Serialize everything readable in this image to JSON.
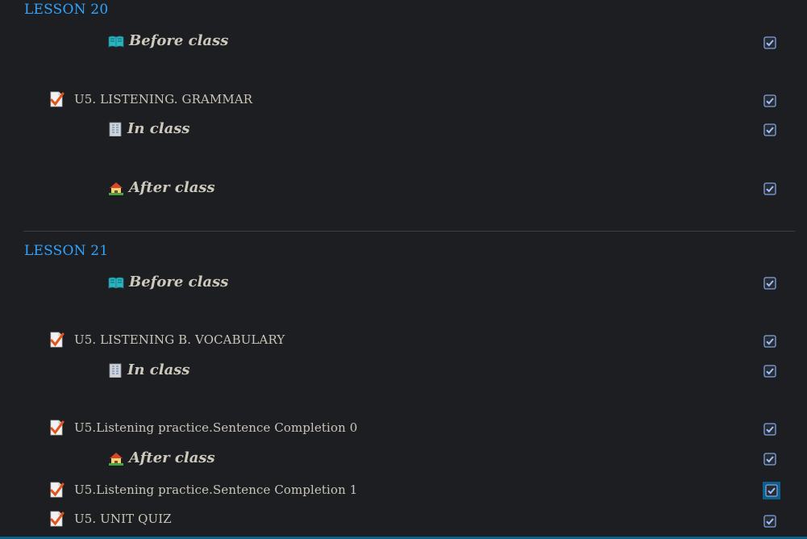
{
  "lessons": [
    {
      "title": "LESSON 20",
      "sections": {
        "before": "Before class",
        "in": "In class",
        "after": "After class"
      },
      "activities": [
        "U5. LISTENING. GRAMMAR"
      ]
    },
    {
      "title": "LESSON 21",
      "sections": {
        "before": "Before class",
        "in": "In class",
        "after": "After class"
      },
      "activities": [
        "U5. LISTENING B. VOCABULARY",
        "U5.Listening practice.Sentence Completion 0",
        "U5.Listening practice.Sentence Completion 1",
        "U5. UNIT QUIZ"
      ]
    }
  ],
  "icons": {
    "before": "open-book-icon",
    "in": "building-icon",
    "after": "house-icon",
    "activity": "assignment-check-icon",
    "completion": "checkbox-checked-icon"
  },
  "colors": {
    "background": "#1d1e21",
    "lesson_title": "#2fa4ff",
    "text": "#c9c5b9",
    "checkbox": "#5b8bd6",
    "highlight": "#0f5f8c",
    "check_accent": "#e2541a"
  }
}
